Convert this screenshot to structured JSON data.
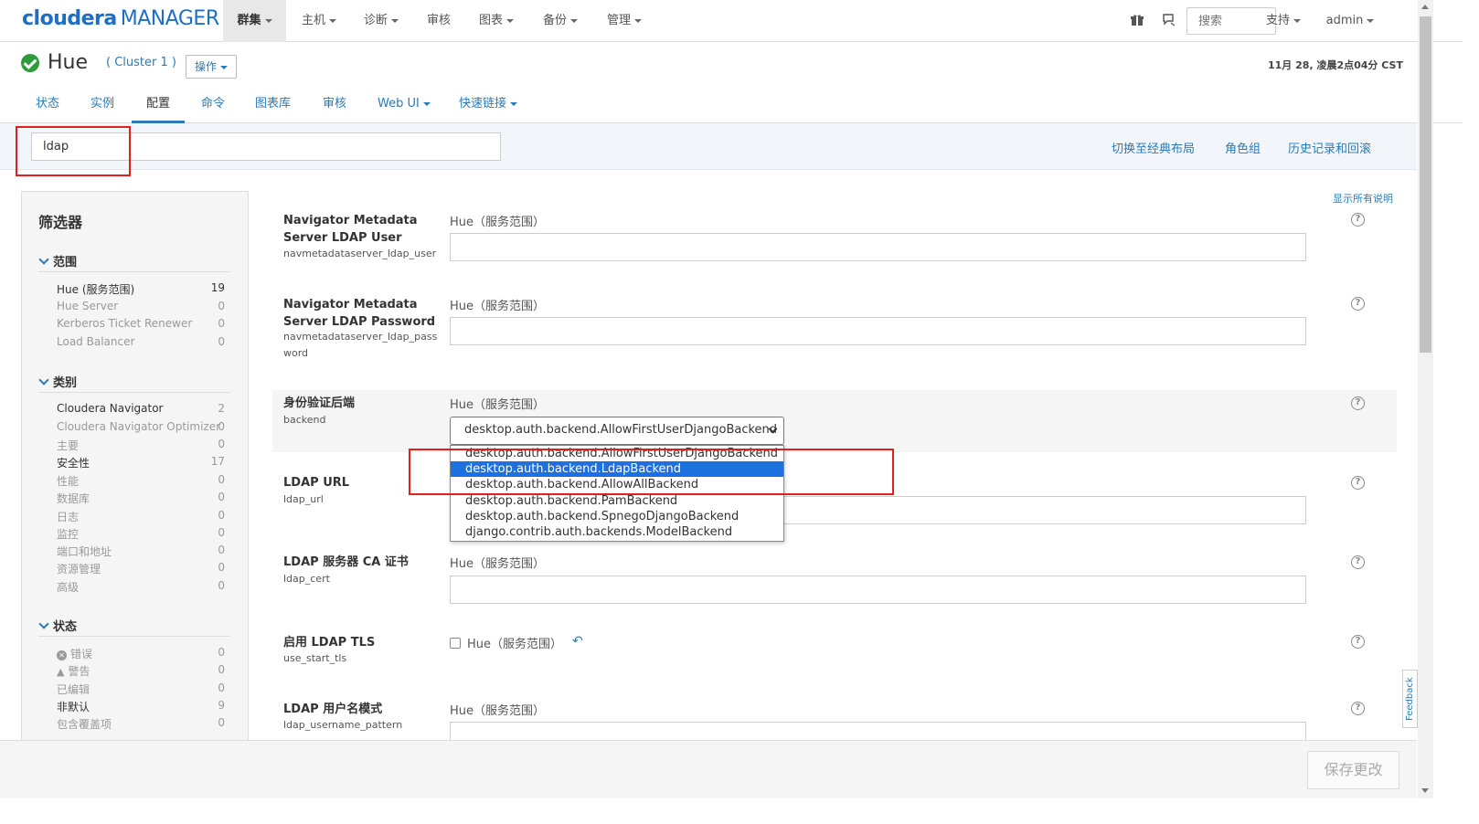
{
  "brand": {
    "logo_main": "cloudera",
    "logo_sub": "MANAGER"
  },
  "topnav": {
    "items": [
      "群集",
      "主机",
      "诊断",
      "审核",
      "图表",
      "备份",
      "管理"
    ],
    "search_placeholder": "搜索",
    "support": "支持",
    "user": "admin"
  },
  "service": {
    "name": "Hue",
    "cluster": "( Cluster 1 )",
    "ops": "操作",
    "time": "11月 28, 凌晨2点04分 CST"
  },
  "tabs": [
    "状态",
    "实例",
    "配置",
    "命令",
    "图表库",
    "审核",
    "Web UI",
    "快速链接"
  ],
  "filter": {
    "value": "ldap",
    "links": [
      "切换至经典布局",
      "角色组",
      "历史记录和回滚"
    ]
  },
  "sidebar": {
    "title": "筛选器",
    "scope_title": "范围",
    "scope_items": [
      {
        "label": "Hue (服务范围)",
        "count": "19"
      },
      {
        "label": "Hue Server",
        "count": "0"
      },
      {
        "label": "Kerberos Ticket Renewer",
        "count": "0"
      },
      {
        "label": "Load Balancer",
        "count": "0"
      }
    ],
    "category_title": "类别",
    "category_items": [
      {
        "label": "Cloudera Navigator",
        "count": "2"
      },
      {
        "label": "Cloudera Navigator Optimizer",
        "count": "0"
      },
      {
        "label": "主要",
        "count": "0"
      },
      {
        "label": "安全性",
        "count": "17"
      },
      {
        "label": "性能",
        "count": "0"
      },
      {
        "label": "数据库",
        "count": "0"
      },
      {
        "label": "日志",
        "count": "0"
      },
      {
        "label": "监控",
        "count": "0"
      },
      {
        "label": "端口和地址",
        "count": "0"
      },
      {
        "label": "资源管理",
        "count": "0"
      },
      {
        "label": "高级",
        "count": "0"
      }
    ],
    "status_title": "状态",
    "status_items": [
      {
        "label": "错误",
        "count": "0"
      },
      {
        "label": "警告",
        "count": "0"
      },
      {
        "label": "已编辑",
        "count": "0"
      },
      {
        "label": "非默认",
        "count": "9"
      },
      {
        "label": "包含覆盖项",
        "count": "0"
      }
    ]
  },
  "show_all_desc": "显示所有说明",
  "configs": [
    {
      "title": "Navigator Metadata Server LDAP User",
      "key": "navmetadataserver_ldap_user",
      "scope": "Hue（服务范围）"
    },
    {
      "title": "Navigator Metadata Server LDAP Password",
      "key": "navmetadataserver_ldap_password",
      "scope": "Hue（服务范围）"
    },
    {
      "title": "身份验证后端",
      "key": "backend",
      "scope": "Hue（服务范围）"
    },
    {
      "title": "LDAP URL",
      "key": "ldap_url",
      "scope": "Hue（服务范围）"
    },
    {
      "title": "LDAP 服务器 CA 证书",
      "key": "ldap_cert",
      "scope": "Hue（服务范围）"
    },
    {
      "title": "启用 LDAP TLS",
      "key": "use_start_tls",
      "scope": "Hue（服务范围）"
    },
    {
      "title": "LDAP 用户名模式",
      "key": "ldap_username_pattern",
      "scope": "Hue（服务范围）"
    }
  ],
  "backend_select": {
    "selected": "desktop.auth.backend.AllowFirstUserDjangoBackend",
    "options": [
      "desktop.auth.backend.AllowFirstUserDjangoBackend",
      "desktop.auth.backend.LdapBackend",
      "desktop.auth.backend.AllowAllBackend",
      "desktop.auth.backend.PamBackend",
      "desktop.auth.backend.SpnegoDjangoBackend",
      "django.contrib.auth.backends.ModelBackend"
    ],
    "highlighted": "desktop.auth.backend.LdapBackend"
  },
  "save_button": "保存更改",
  "feedback": "Feedback",
  "colors": {
    "accent": "#2a7ab8",
    "highlight": "#1e6fe0",
    "annotation": "#e0201c",
    "ok": "#2e9c3a"
  }
}
